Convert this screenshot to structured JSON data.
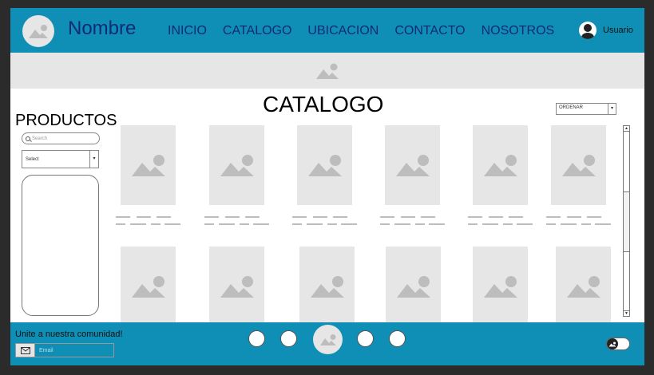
{
  "header": {
    "brand": "Nombre",
    "nav": [
      "INICIO",
      "CATALOGO",
      "UBICACION",
      "CONTACTO",
      "NOSOTROS"
    ],
    "user_label": "Usuario"
  },
  "main": {
    "title": "CATALOGO",
    "sort_label": "ORDENAR"
  },
  "sidebar": {
    "title": "PRODUCTOS",
    "search_placeholder": "Search",
    "select_label": "Select"
  },
  "footer": {
    "community_label": "Unite a nuestra comunidad!",
    "email_placeholder": "Email"
  },
  "colors": {
    "bar": "#0f8fb5",
    "nav_text": "#0f2a78",
    "placeholder_fill": "#e6e6e6"
  },
  "icons": {
    "logo": "image-placeholder-icon",
    "user": "user-avatar-icon",
    "search": "search-icon",
    "email": "envelope-icon"
  }
}
